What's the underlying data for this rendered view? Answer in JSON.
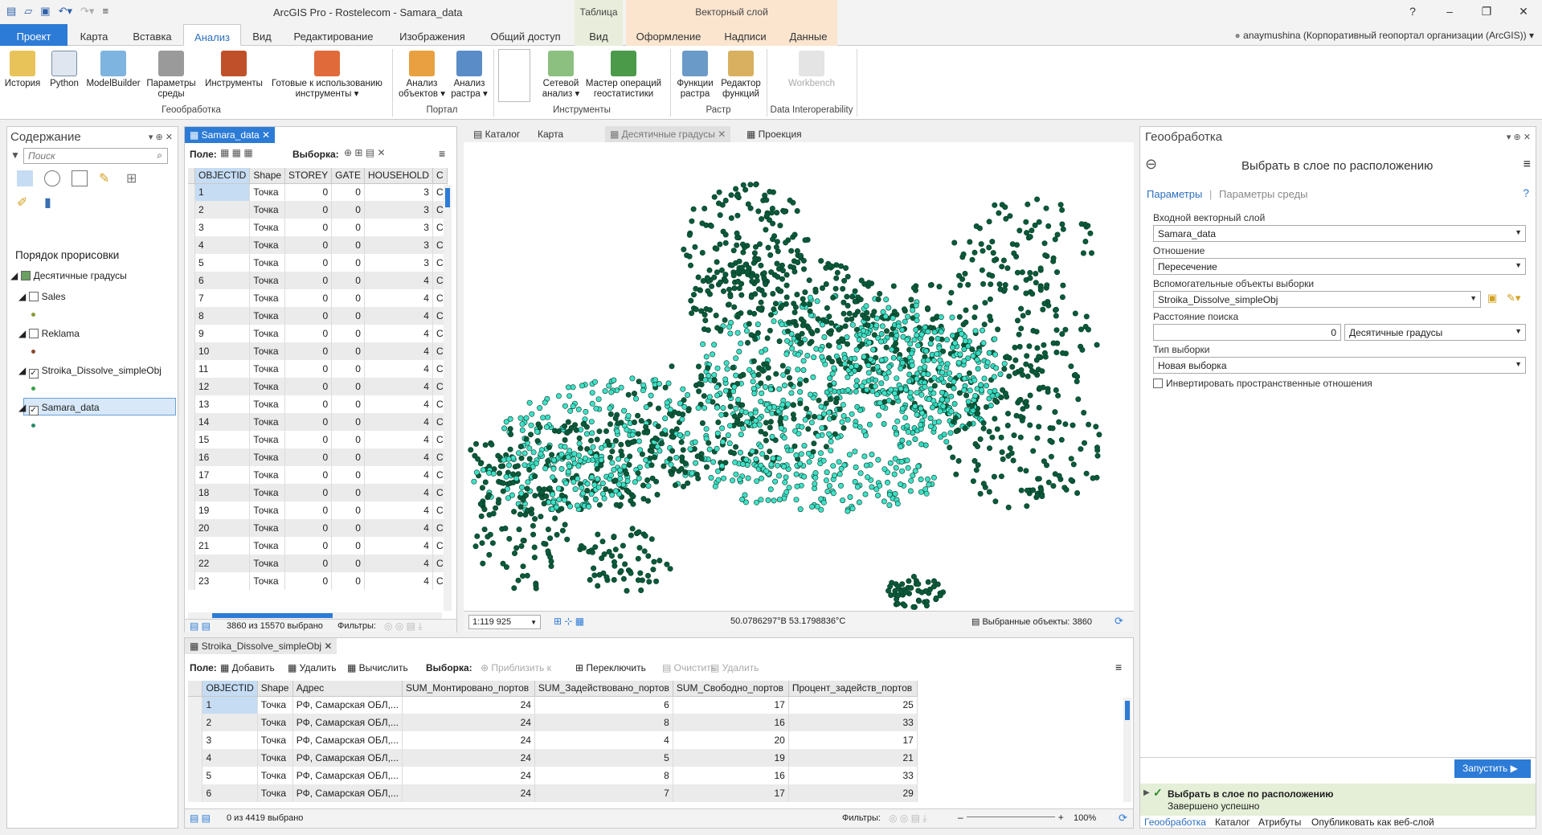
{
  "app_title": "ArcGIS Pro - Rostelecom - Samara_data",
  "context_tabs": {
    "table": "Таблица",
    "vector": "Векторный слой"
  },
  "ribbon_tabs": [
    "Проект",
    "Карта",
    "Вставка",
    "Анализ",
    "Вид",
    "Редактирование",
    "Изображения",
    "Общий доступ",
    "Вид",
    "Оформление",
    "Надписи",
    "Данные"
  ],
  "user": "anaymushina (Корпоративный геопортал организации (ArcGIS))",
  "ribbon": {
    "buttons": [
      "История",
      "Python",
      "ModelBuilder",
      "Параметры среды",
      "Инструменты",
      "Готовые к использованию инструменты",
      "Анализ объектов",
      "Анализ растра",
      "Сетевой анализ",
      "Мастер операций геостатистики",
      "Функции растра",
      "Редактор функций",
      "Workbench"
    ],
    "groups": [
      "Геообработка",
      "Портал",
      "Инструменты",
      "Растр",
      "Data Interoperability"
    ]
  },
  "contents": {
    "title": "Содержание",
    "search_placeholder": "Поиск",
    "drawing_order": "Порядок прорисовки",
    "map_name": "Десятичные градусы",
    "layers": [
      {
        "name": "Sales",
        "checked": false,
        "color": "#8b9a3a"
      },
      {
        "name": "Reklama",
        "checked": false,
        "color": "#8a4a2a"
      },
      {
        "name": "Stroika_Dissolve_simpleObj",
        "checked": true,
        "color": "#3aa04a"
      },
      {
        "name": "Samara_data",
        "checked": true,
        "color": "#2a8a6a"
      }
    ]
  },
  "table1": {
    "tab": "Samara_data",
    "field_label": "Поле:",
    "selection_label": "Выборка:",
    "columns": [
      "OBJECTID",
      "Shape",
      "STOREY",
      "GATE",
      "HOUSEHOLD",
      "C"
    ],
    "rows": [
      [
        "1",
        "Точка",
        "0",
        "0",
        "3",
        "C"
      ],
      [
        "2",
        "Точка",
        "0",
        "0",
        "3",
        "C"
      ],
      [
        "3",
        "Точка",
        "0",
        "0",
        "3",
        "C"
      ],
      [
        "4",
        "Точка",
        "0",
        "0",
        "3",
        "C"
      ],
      [
        "5",
        "Точка",
        "0",
        "0",
        "3",
        "C"
      ],
      [
        "6",
        "Точка",
        "0",
        "0",
        "4",
        "C"
      ],
      [
        "7",
        "Точка",
        "0",
        "0",
        "4",
        "C"
      ],
      [
        "8",
        "Точка",
        "0",
        "0",
        "4",
        "C"
      ],
      [
        "9",
        "Точка",
        "0",
        "0",
        "4",
        "C"
      ],
      [
        "10",
        "Точка",
        "0",
        "0",
        "4",
        "C"
      ],
      [
        "11",
        "Точка",
        "0",
        "0",
        "4",
        "C"
      ],
      [
        "12",
        "Точка",
        "0",
        "0",
        "4",
        "C"
      ],
      [
        "13",
        "Точка",
        "0",
        "0",
        "4",
        "C"
      ],
      [
        "14",
        "Точка",
        "0",
        "0",
        "4",
        "C"
      ],
      [
        "15",
        "Точка",
        "0",
        "0",
        "4",
        "C"
      ],
      [
        "16",
        "Точка",
        "0",
        "0",
        "4",
        "C"
      ],
      [
        "17",
        "Точка",
        "0",
        "0",
        "4",
        "C"
      ],
      [
        "18",
        "Точка",
        "0",
        "0",
        "4",
        "C"
      ],
      [
        "19",
        "Точка",
        "0",
        "0",
        "4",
        "C"
      ],
      [
        "20",
        "Точка",
        "0",
        "0",
        "4",
        "C"
      ],
      [
        "21",
        "Точка",
        "0",
        "0",
        "4",
        "C"
      ],
      [
        "22",
        "Точка",
        "0",
        "0",
        "4",
        "C"
      ],
      [
        "23",
        "Точка",
        "0",
        "0",
        "4",
        "C"
      ]
    ],
    "status": "3860 из 15570 выбрано",
    "filters": "Фильтры:"
  },
  "map_tabs": [
    "Каталог",
    "Карта",
    "Десятичные градусы",
    "Проекция"
  ],
  "map_status": {
    "scale": "1:119 925",
    "coords": "50.0786297°В 53.1798836°С",
    "selected": "Выбранные объекты: 3860"
  },
  "table2": {
    "tab": "Stroika_Dissolve_simpleObj",
    "field_label": "Поле:",
    "add": "Добавить",
    "delete": "Удалить",
    "calc": "Вычислить",
    "selection_label": "Выборка:",
    "zoom": "Приблизить к",
    "switch": "Переключить",
    "clear": "Очистить",
    "remove": "Удалить",
    "columns": [
      "OBJECTID",
      "Shape",
      "Адрес",
      "SUM_Монтировано_портов",
      "SUM_Задействовано_портов",
      "SUM_Свободно_портов",
      "Процент_задейств_портов"
    ],
    "rows": [
      [
        "1",
        "Точка",
        "РФ, Самарская ОБЛ,...",
        "24",
        "6",
        "17",
        "25"
      ],
      [
        "2",
        "Точка",
        "РФ, Самарская ОБЛ,...",
        "24",
        "8",
        "16",
        "33"
      ],
      [
        "3",
        "Точка",
        "РФ, Самарская ОБЛ,...",
        "24",
        "4",
        "20",
        "17"
      ],
      [
        "4",
        "Точка",
        "РФ, Самарская ОБЛ,...",
        "24",
        "5",
        "19",
        "21"
      ],
      [
        "5",
        "Точка",
        "РФ, Самарская ОБЛ,...",
        "24",
        "8",
        "16",
        "33"
      ],
      [
        "6",
        "Точка",
        "РФ, Самарская ОБЛ,...",
        "24",
        "7",
        "17",
        "29"
      ]
    ],
    "status": "0 из 4419 выбрано",
    "filters": "Фильтры:",
    "zoom_level": "100%"
  },
  "geoprocessing": {
    "title": "Геообработка",
    "tool": "Выбрать в слое по расположению",
    "tab_params": "Параметры",
    "tab_env": "Параметры среды",
    "input_label": "Входной векторный слой",
    "input_value": "Samara_data",
    "relation_label": "Отношение",
    "relation_value": "Пересечение",
    "select_features_label": "Вспомогательные объекты выборки",
    "select_features_value": "Stroika_Dissolve_simpleObj",
    "distance_label": "Расстояние поиска",
    "distance_value": "0",
    "distance_unit": "Десятичные градусы",
    "selection_type_label": "Тип выборки",
    "selection_type_value": "Новая выборка",
    "invert_label": "Инвертировать пространственные отношения",
    "run": "Запустить",
    "result_title": "Выбрать в слое по расположению",
    "result_status": "Завершено успешно"
  },
  "bottom_tabs": [
    "Геообработка",
    "Каталог",
    "Атрибуты",
    "Опубликовать как веб-слой"
  ]
}
